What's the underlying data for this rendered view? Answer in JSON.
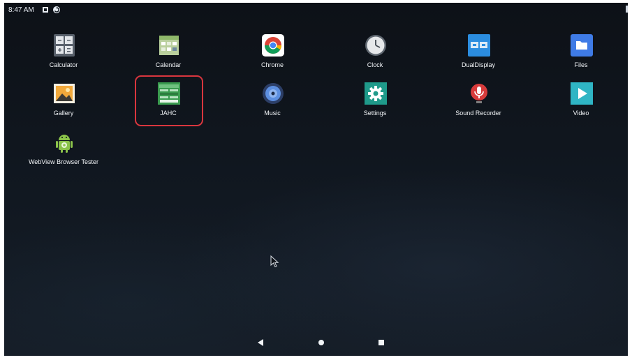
{
  "status_bar": {
    "time": "8:47 AM",
    "icons": [
      "notification-square-icon",
      "sync-icon"
    ]
  },
  "apps": [
    {
      "label": "Calculator",
      "icon": "calculator-icon",
      "color": "#5b6470"
    },
    {
      "label": "Calendar",
      "icon": "calendar-icon",
      "color": "#9bc27a"
    },
    {
      "label": "Chrome",
      "icon": "chrome-icon",
      "color": "#ffffff"
    },
    {
      "label": "Clock",
      "icon": "clock-icon",
      "color": "#e8e8e8"
    },
    {
      "label": "DualDisplay",
      "icon": "dual-display-icon",
      "color": "#2b8de0"
    },
    {
      "label": "Files",
      "icon": "files-icon",
      "color": "#3f7be6"
    },
    {
      "label": "Gallery",
      "icon": "gallery-icon",
      "color": "#f2a93b"
    },
    {
      "label": "JAHC",
      "icon": "jahc-icon",
      "color": "#3a9b4f"
    },
    {
      "label": "Music",
      "icon": "music-icon",
      "color": "#5d8fe0"
    },
    {
      "label": "Settings",
      "icon": "settings-icon",
      "color": "#1f9a8a"
    },
    {
      "label": "Sound Recorder",
      "icon": "sound-recorder-icon",
      "color": "#d83b3b"
    },
    {
      "label": "Video",
      "icon": "video-icon",
      "color": "#2fb5c4"
    },
    {
      "label": "WebView Browser Tester",
      "icon": "android-icon",
      "color": "#8bc34a"
    }
  ],
  "highlight_color": "#d9363e",
  "navigation": {
    "buttons": [
      "back-icon",
      "home-icon",
      "recents-icon"
    ]
  }
}
